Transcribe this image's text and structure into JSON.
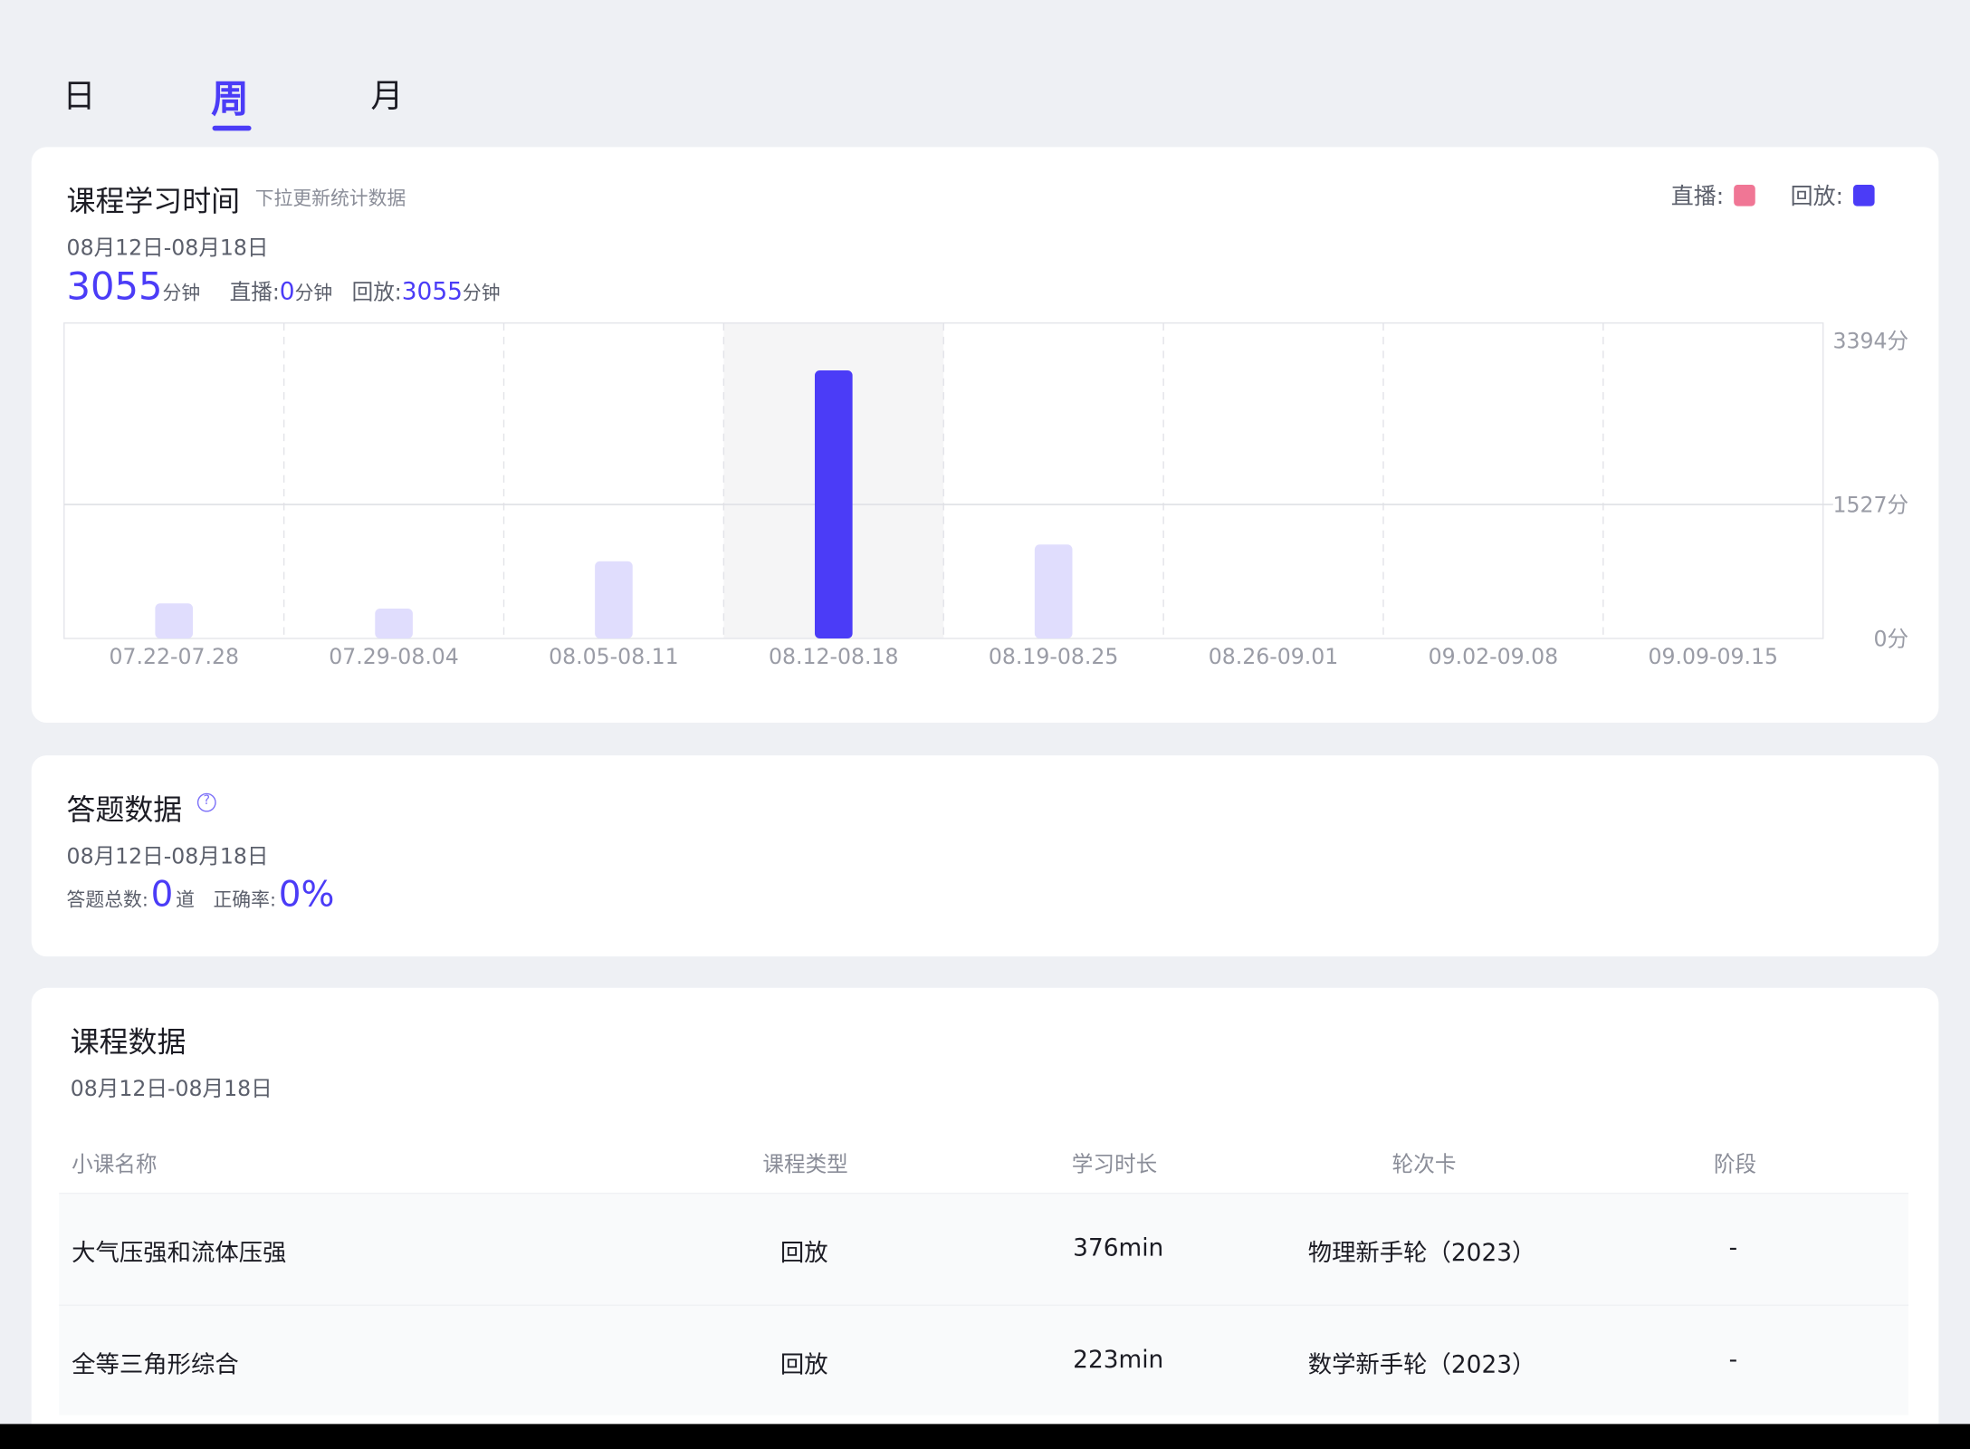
{
  "tabs": [
    "日",
    "周",
    "月"
  ],
  "active_tab": "周",
  "time_card": {
    "title": "课程学习时间",
    "hint": "下拉更新统计数据",
    "legend": [
      {
        "label": "直播:",
        "color": "#f07695"
      },
      {
        "label": "回放:",
        "color": "#4b3cf7"
      }
    ],
    "date_range": "08月12日-08月18日",
    "total_value": "3055",
    "total_unit": "分钟",
    "live_label": "直播:",
    "live_value": "0",
    "live_unit": "分钟",
    "replay_label": "回放:",
    "replay_value": "3055",
    "replay_unit": "分钟"
  },
  "chart_data": {
    "type": "bar",
    "categories": [
      "07.22-07.28",
      "07.29-08.04",
      "08.05-08.11",
      "08.12-08.18",
      "08.19-08.25",
      "08.26-09.01",
      "09.02-09.08",
      "09.09-09.15"
    ],
    "series": [
      {
        "name": "回放",
        "values": [
          400,
          340,
          880,
          3055,
          1070,
          0,
          0,
          0
        ]
      }
    ],
    "selected_category": "08.12-08.18",
    "highlight_color": "#4b3cf7",
    "muted_color": "#e0ddfd",
    "y_ticks": [
      "3394分",
      "1527分",
      "0分"
    ],
    "y_tick_values": [
      3394,
      1527,
      0
    ],
    "ylim": [
      0,
      3394
    ],
    "grid": true
  },
  "quiz_card": {
    "title": "答题数据",
    "date_range": "08月12日-08月18日",
    "total_label": "答题总数:",
    "total_value": "0",
    "total_unit": "道",
    "accuracy_label": "正确率:",
    "accuracy_value": "0%"
  },
  "course_card": {
    "title": "课程数据",
    "date_range": "08月12日-08月18日",
    "columns": [
      "小课名称",
      "课程类型",
      "学习时长",
      "轮次卡",
      "阶段"
    ],
    "rows": [
      [
        "大气压强和流体压强",
        "回放",
        "376min",
        "物理新手轮（2023）",
        "-"
      ],
      [
        "全等三角形综合",
        "回放",
        "223min",
        "数学新手轮（2023）",
        "-"
      ]
    ]
  }
}
